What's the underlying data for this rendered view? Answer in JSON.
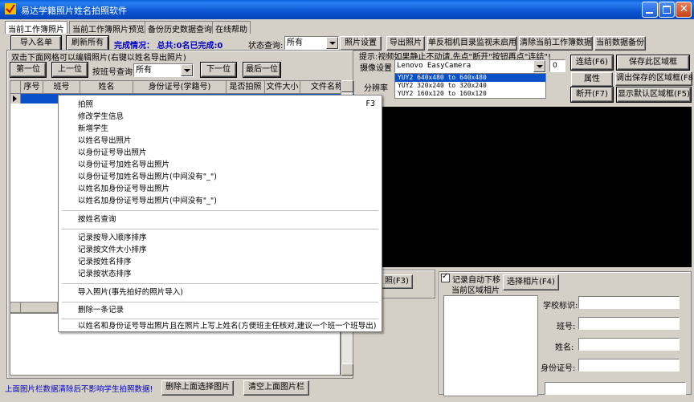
{
  "window": {
    "title": "易达学籍照片姓名拍照软件"
  },
  "tabs": [
    {
      "label": "当前工作簿照片",
      "active": true
    },
    {
      "label": "当前工作簿照片预览",
      "active": false
    },
    {
      "label": "备份历史数据查询",
      "active": false
    },
    {
      "label": "在线帮助",
      "active": false
    }
  ],
  "toolbar": {
    "import_list": "导入名单",
    "refresh_all": "刷新所有",
    "status_text": "完成情况： 总共:0名已完成:0",
    "status_query_label": "状态查询:",
    "status_query_value": "所有",
    "photo_settings": "照片设置",
    "export_photos": "导出照片",
    "dslr_monitor": "单反相机目录监视未启用",
    "clear_workbook": "清除当前工作簿数据",
    "backup_data": "当前数据备份"
  },
  "left": {
    "hint": "双击下面网格可以编辑照片(右键以姓名导出照片)",
    "first": "第一位",
    "prev": "上一位",
    "class_query_label": "按班号查询",
    "class_query_value": "所有",
    "next": "下一位",
    "last": "最后一位",
    "columns": [
      "序号",
      "班号",
      "姓名",
      "身份证号(学籍号)",
      "是否拍照",
      "文件大小",
      "文件名称"
    ]
  },
  "right": {
    "hint": "提示:视频如果静止不动请,先点\"断开\"按钮再点\"连结\"!",
    "camera_label": "摄像设置",
    "camera_value": "Lenovo EasyCamera",
    "camera_index": "0",
    "resolution_label": "分辨率",
    "resolutions": [
      "YUY2 640x480 to 640x480",
      "YUY2 320x240 to 320x240",
      "YUY2 160x120 to 160x120"
    ],
    "connect": "连结(F6)",
    "properties": "属性",
    "disconnect": "断开(F7)",
    "save_region": "保存此区域框",
    "load_region": "调出保存的区域框(F8)",
    "default_region": "显示默认区域框(F5)",
    "photo_btn": "照(F3)",
    "auto_move_label": "记录自动下移",
    "current_region_photo": "当前区域相片",
    "select_photo": "选择相片(F4)",
    "school_id_label": "学校标识:",
    "class_label": "班号:",
    "name_label": "姓名:",
    "id_label": "身份证号:"
  },
  "context_menu": {
    "items": [
      {
        "label": "拍照",
        "shortcut": "F3"
      },
      {
        "label": "修改学生信息"
      },
      {
        "label": "新增学生"
      },
      {
        "label": "以姓名导出照片"
      },
      {
        "label": "以身份证号导出照片"
      },
      {
        "label": "以身份证号加姓名导出照片"
      },
      {
        "label": "以身份证号加姓名导出照片(中间没有\"_\")"
      },
      {
        "label": "以姓名加身份证号导出照片"
      },
      {
        "label": "以姓名加身份证号导出照片(中间没有\"_\")"
      },
      {
        "label": "按姓名查询"
      },
      {
        "label": "记录按导入顺序排序"
      },
      {
        "label": "记录按文件大小排序"
      },
      {
        "label": "记录按姓名排序"
      },
      {
        "label": "记录按状态排序"
      },
      {
        "label": "导入照片(事先拍好的照片导入)"
      },
      {
        "label": "删除一条记录"
      },
      {
        "label": "以姓名和身份证号导出照片且在照片上写上姓名(方便班主任核对,建议一个班一个班导出)"
      }
    ]
  },
  "bottom": {
    "message": "上面图片栏数据清除后不影响学生拍照数据!",
    "delete_selected": "删除上面选择图片",
    "clear_gallery": "清空上面图片栏"
  }
}
